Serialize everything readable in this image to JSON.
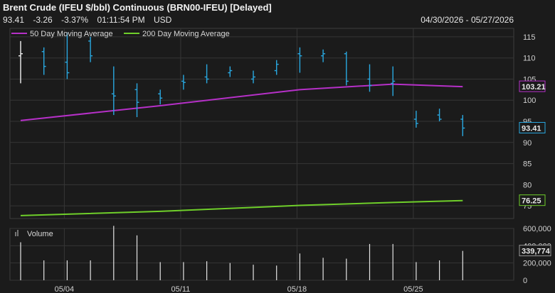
{
  "header": {
    "title": "Brent Crude (IFEU $/bbl) Continuous (BRN00-IFEU) [Delayed]",
    "last": "93.41",
    "change": "-3.26",
    "change_pct": "-3.37%",
    "time": "01:11:54 PM",
    "currency": "USD",
    "date_range": "04/30/2026 - 05/27/2026"
  },
  "colors": {
    "background": "#1b1b1b",
    "price_bars": "#29a8e0",
    "ma50": "#b630c8",
    "ma200": "#6fcf2a",
    "volume": "#e4e4e4"
  },
  "chart_data": [
    {
      "type": "ohlc",
      "title": "Brent Crude (IFEU $/bbl) Continuous (BRN00-IFEU) [Delayed]",
      "x_tick_labels": [
        "05/04",
        "05/11",
        "05/18",
        "05/25"
      ],
      "y_ticks": [
        75,
        80,
        85,
        90,
        95,
        100,
        105,
        110,
        115
      ],
      "ylim": [
        72,
        117
      ],
      "grid": true,
      "legend": [
        "50 Day Moving Average",
        "200 Day Moving Average"
      ],
      "legend_position": "top-left",
      "bars": [
        {
          "date": "04/30",
          "open": 110.5,
          "high": 114,
          "low": 104,
          "close": 111
        },
        {
          "date": "05/01",
          "open": 111.5,
          "high": 112.5,
          "low": 106,
          "close": 108
        },
        {
          "date": "05/04",
          "open": 109,
          "high": 116,
          "low": 105,
          "close": 106.5
        },
        {
          "date": "05/05",
          "open": 114,
          "high": 115,
          "low": 109,
          "close": 110.5
        },
        {
          "date": "05/06",
          "open": 101.5,
          "high": 108,
          "low": 96.5,
          "close": 101
        },
        {
          "date": "05/07",
          "open": 102.5,
          "high": 104,
          "low": 96,
          "close": 99.5
        },
        {
          "date": "05/08",
          "open": 101.5,
          "high": 102.5,
          "low": 99,
          "close": 100.5
        },
        {
          "date": "05/11",
          "open": 104.5,
          "high": 106,
          "low": 102.5,
          "close": 104.2
        },
        {
          "date": "05/12",
          "open": 105.5,
          "high": 108.5,
          "low": 104,
          "close": 105
        },
        {
          "date": "05/13",
          "open": 106.5,
          "high": 108,
          "low": 105.5,
          "close": 107
        },
        {
          "date": "05/14",
          "open": 105,
          "high": 107,
          "low": 104,
          "close": 105.5
        },
        {
          "date": "05/15",
          "open": 107,
          "high": 109.5,
          "low": 106,
          "close": 108.5
        },
        {
          "date": "05/18",
          "open": 111,
          "high": 112.5,
          "low": 106.5,
          "close": 110.5
        },
        {
          "date": "05/19",
          "open": 110.5,
          "high": 112,
          "low": 109,
          "close": 111
        },
        {
          "date": "05/20",
          "open": 111,
          "high": 111.5,
          "low": 103.5,
          "close": 104.5
        },
        {
          "date": "05/21",
          "open": 105,
          "high": 108.5,
          "low": 102,
          "close": 103.5
        },
        {
          "date": "05/22",
          "open": 104,
          "high": 108,
          "low": 101,
          "close": 104.5
        },
        {
          "date": "05/26",
          "open": 95.5,
          "high": 97.5,
          "low": 93.5,
          "close": 94.5
        },
        {
          "date": "05/27",
          "open": 96.5,
          "high": 98,
          "low": 95,
          "close": 95.5
        },
        {
          "date": "05/28",
          "open": 95.5,
          "high": 96.5,
          "low": 91.5,
          "close": 93.41
        }
      ],
      "ma50": {
        "name": "50 Day Moving Average",
        "points": [
          [
            0,
            95.2
          ],
          [
            6,
            98.7
          ],
          [
            12,
            102.5
          ],
          [
            16,
            103.8
          ],
          [
            19,
            103.21
          ]
        ]
      },
      "ma200": {
        "name": "200 Day Moving Average",
        "points": [
          [
            0,
            72.7
          ],
          [
            6,
            73.7
          ],
          [
            12,
            75.1
          ],
          [
            16,
            75.8
          ],
          [
            19,
            76.25
          ]
        ]
      },
      "last_labels": {
        "ma50": "103.21",
        "price": "93.41",
        "ma200": "76.25"
      }
    },
    {
      "type": "bar",
      "title": "Volume",
      "y_ticks": [
        0,
        200000,
        400000,
        600000
      ],
      "y_tick_labels": [
        "0",
        "200,000",
        "400,000",
        "600,000"
      ],
      "ylim": [
        0,
        600000
      ],
      "values": [
        440000,
        230000,
        230000,
        230000,
        630000,
        520000,
        210000,
        210000,
        220000,
        200000,
        180000,
        170000,
        310000,
        260000,
        250000,
        420000,
        420000,
        210000,
        230000,
        339774
      ],
      "last_label": "339,774"
    }
  ]
}
